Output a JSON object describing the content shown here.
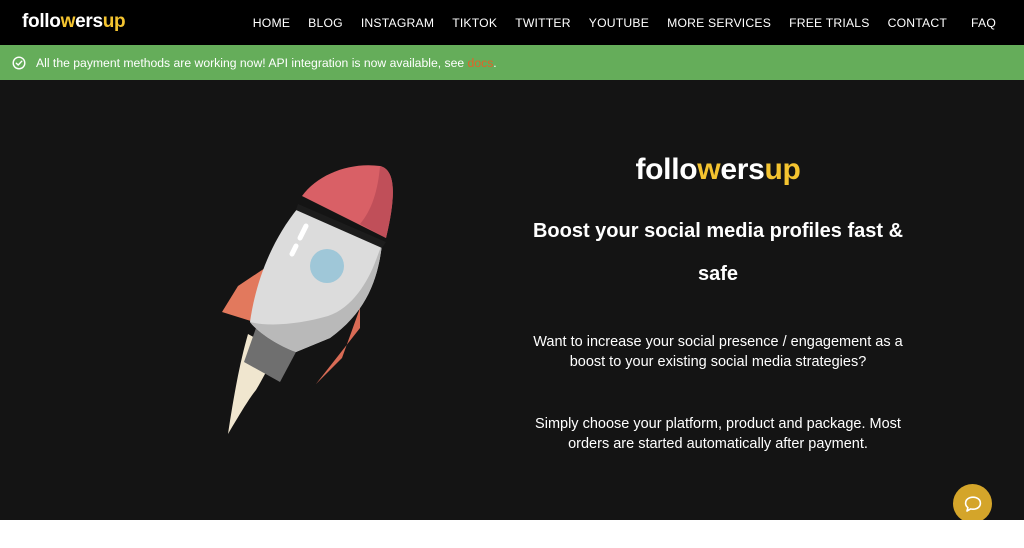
{
  "header": {
    "logo": {
      "part1": "follo",
      "part2": "w",
      "part3": "ers",
      "part4": "up"
    },
    "nav": [
      {
        "label": "HOME"
      },
      {
        "label": "BLOG"
      },
      {
        "label": "INSTAGRAM"
      },
      {
        "label": "TIKTOK"
      },
      {
        "label": "TWITTER"
      },
      {
        "label": "YOUTUBE"
      },
      {
        "label": "MORE SERVICES"
      },
      {
        "label": "FREE TRIALS"
      },
      {
        "label": "CONTACT"
      },
      {
        "label": "FAQ"
      }
    ]
  },
  "notice": {
    "icon": "check-circle-icon",
    "text": "All the payment methods are working now! API integration is now available, see ",
    "link": "docs",
    "suffix": "."
  },
  "hero": {
    "illustration": "rocket-illustration",
    "brand": {
      "part1": "follo",
      "part2": "w",
      "part3": "ers",
      "part4": "up"
    },
    "headline_line1": "Boost your social media profiles fast &",
    "headline_line2": "safe",
    "paragraph1_line1": "Want to increase your social presence / engagement as a",
    "paragraph1_line2": "boost to your existing social media strategies?",
    "paragraph2_line1": "Simply choose your platform, product and package. Most",
    "paragraph2_line2": "orders are started automatically after payment."
  },
  "chat": {
    "icon": "chat-bubble-icon"
  },
  "colors": {
    "accent": "#f4c430",
    "notice_bg": "#65ad5a",
    "link": "#e2622a",
    "hero_bg": "#141414",
    "chat_bg": "#d4a52a"
  }
}
